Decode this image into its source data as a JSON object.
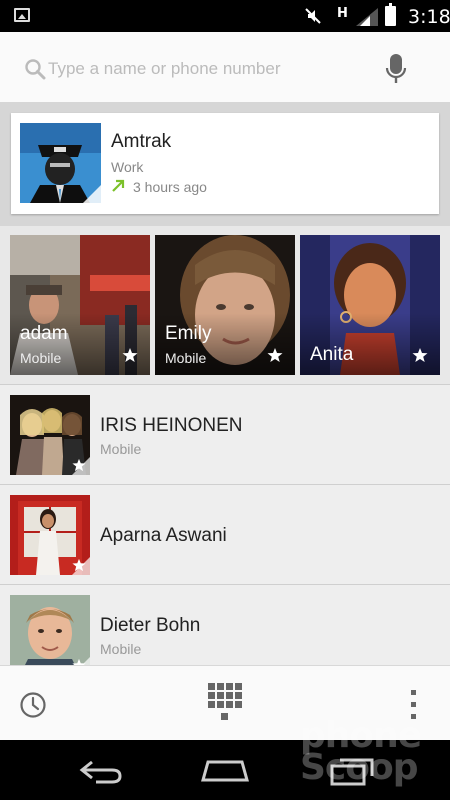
{
  "status_bar": {
    "network": "H",
    "time": "3:18",
    "icons": [
      "image-notification-icon",
      "mute-icon",
      "signal-icon",
      "battery-icon"
    ]
  },
  "search": {
    "placeholder": "Type a name or phone number",
    "value": ""
  },
  "recent_call": {
    "name": "Amtrak",
    "type": "Work",
    "time_ago": "3 hours ago",
    "direction": "outgoing",
    "arrow_color": "#7cc12a"
  },
  "favorites": [
    {
      "name": "adam",
      "type": "Mobile"
    },
    {
      "name": "Emily",
      "type": "Mobile"
    },
    {
      "name": "Anita",
      "type": ""
    }
  ],
  "contacts": [
    {
      "name": "IRIS HEINONEN",
      "type": "Mobile"
    },
    {
      "name": "Aparna Aswani",
      "type": ""
    },
    {
      "name": "Dieter Bohn",
      "type": "Mobile"
    }
  ],
  "bottom_bar": {
    "icons": [
      "recent-history-icon",
      "dialpad-icon",
      "overflow-menu-icon"
    ]
  },
  "watermark": {
    "line1": "phone",
    "line2": "Scoop"
  },
  "colors": {
    "accent_green": "#7cc12a",
    "background": "#e8e8e8"
  }
}
